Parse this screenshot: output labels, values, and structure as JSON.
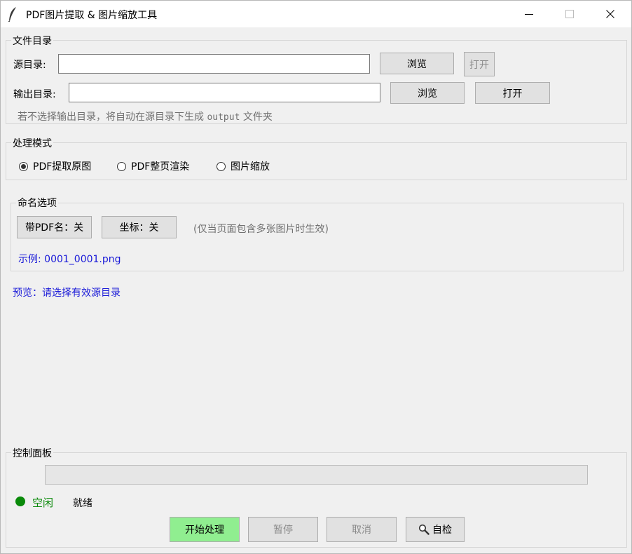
{
  "window": {
    "title": "PDF图片提取 & 图片缩放工具"
  },
  "file_dir": {
    "title": "文件目录",
    "source_label": "源目录:",
    "source_value": "",
    "browse1": "浏览",
    "open1": "打开",
    "output_label": "输出目录:",
    "output_value": "",
    "browse2": "浏览",
    "open2": "打开",
    "hint_prefix": "若不选择输出目录，将自动在源目录下生成",
    "hint_code": "output",
    "hint_suffix": "文件夹"
  },
  "mode": {
    "title": "处理模式",
    "options": [
      "PDF提取原图",
      "PDF整页渲染",
      "图片缩放"
    ],
    "selected": 0
  },
  "naming": {
    "title": "命名选项",
    "with_pdf_name": "带PDF名：关",
    "coords": "坐标：关",
    "note": "(仅当页面包含多张图片时生效)",
    "example": "示例: 0001_0001.png"
  },
  "preview": {
    "text": "预览：请选择有效源目录"
  },
  "control": {
    "title": "控制面板",
    "progress": 0,
    "status": "空闲",
    "status_detail": "就绪",
    "status_color": "#0a8a0a",
    "start": "开始处理",
    "pause": "暂停",
    "cancel": "取消",
    "selfcheck": "自检"
  },
  "icons": {
    "app": "feather-icon",
    "selfcheck": "magnifier-icon"
  },
  "colors": {
    "start_button": "#90ee90",
    "link_blue": "#1a1ad8",
    "status_green": "#0a8a0a"
  }
}
